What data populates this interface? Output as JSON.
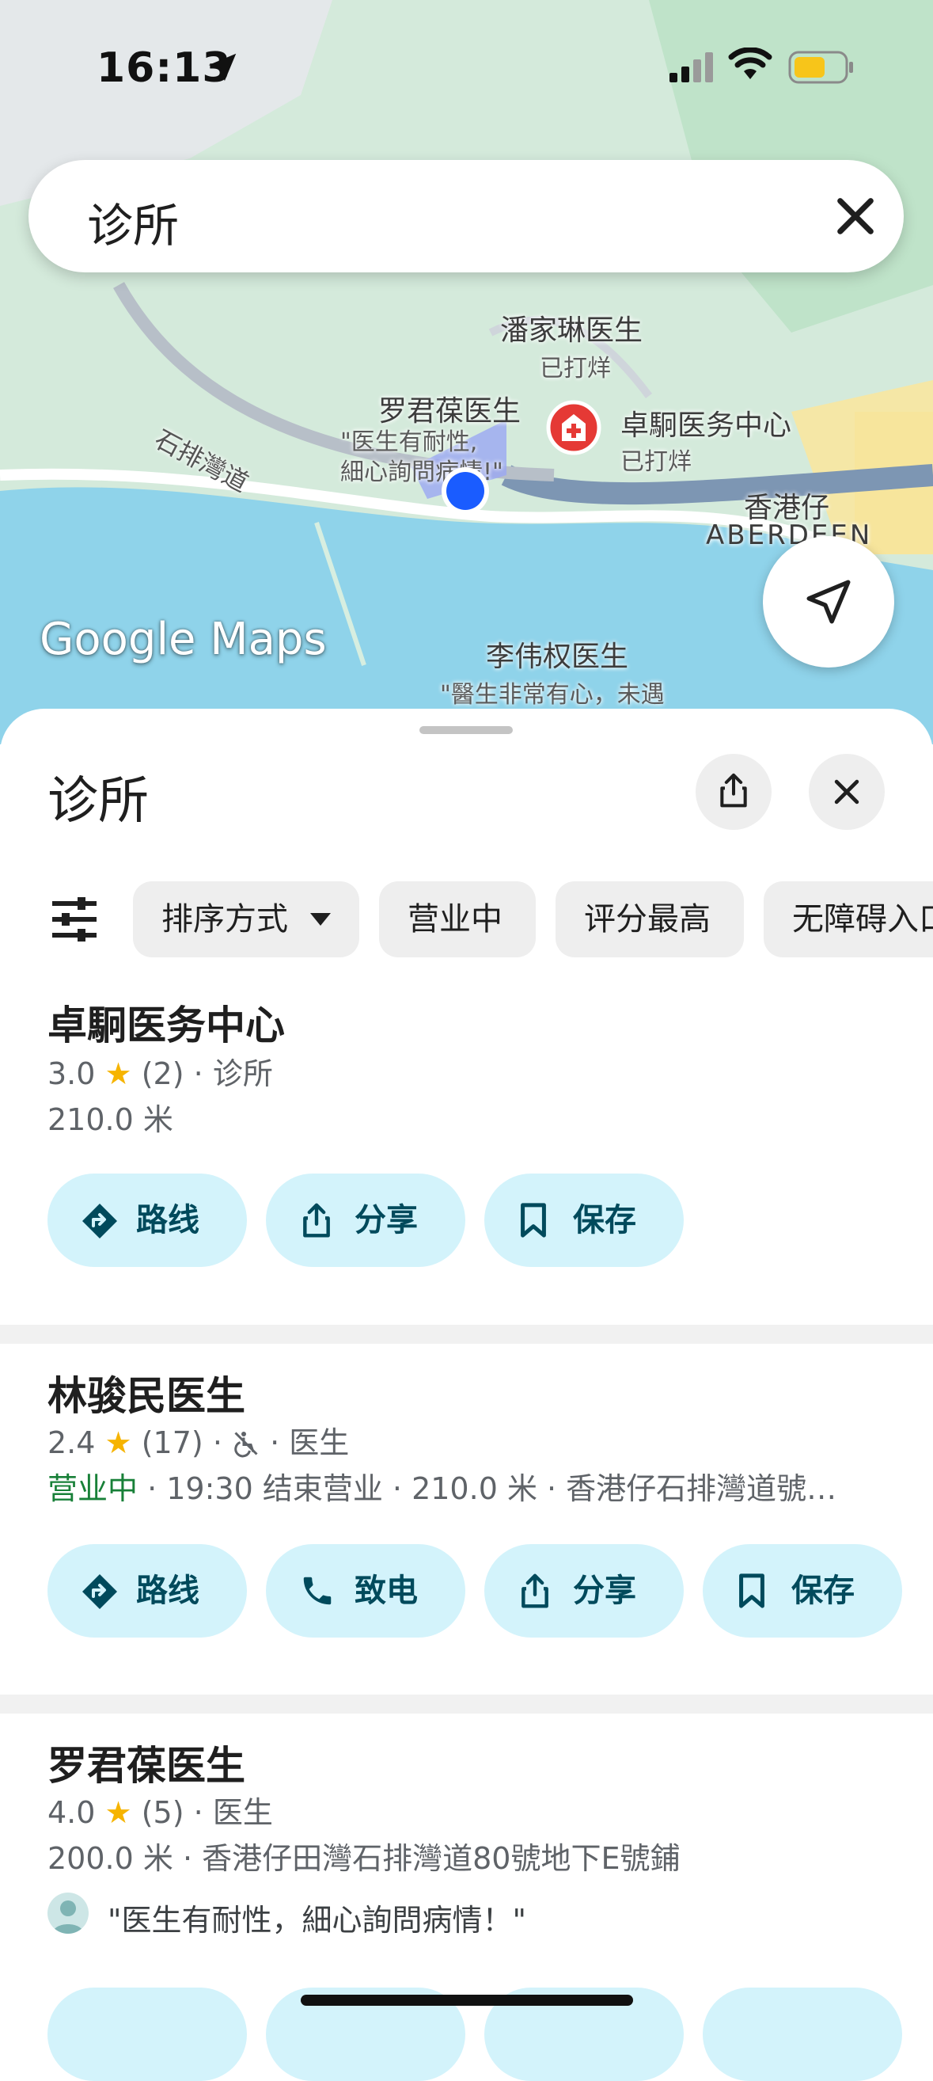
{
  "status_bar": {
    "time": "16:13"
  },
  "search": {
    "query": "诊所"
  },
  "map": {
    "place_labels": [
      {
        "name": "潘家琳医生",
        "sub": "已打烊"
      },
      {
        "name": "罗君葆医生",
        "sub": "\"医生有耐性,\n細心詢問病情!\""
      },
      {
        "name": "卓駉医务中心",
        "sub": "已打烊"
      },
      {
        "name": "香港仔",
        "sub": "ABERDEEN"
      },
      {
        "name": "李伟权医生",
        "sub": "\"醫生非常有心，未遇"
      }
    ],
    "road_label": "石排灣道",
    "logo": "Google Maps"
  },
  "sheet": {
    "title": "诊所",
    "filters": [
      "排序方式",
      "营业中",
      "评分最高",
      "无障碍入口"
    ]
  },
  "results": [
    {
      "name": "卓駉医务中心",
      "rating": "3.0",
      "reviews": "(2)",
      "category": "诊所",
      "distance": "210.0 米",
      "actions": [
        "路线",
        "分享",
        "保存"
      ]
    },
    {
      "name": "林骏民医生",
      "rating": "2.4",
      "reviews": "(17)",
      "category": "医生",
      "open_status": "营业中",
      "hours_detail": " · 19:30 结束营业 · 210.0 米 · 香港仔石排灣道號…",
      "actions": [
        "路线",
        "致电",
        "分享",
        "保存"
      ]
    },
    {
      "name": "罗君葆医生",
      "rating": "4.0",
      "reviews": "(5)",
      "category": "医生",
      "address_line": "200.0 米 · 香港仔田灣石排灣道80號地下E號鋪",
      "review_snippet": "\"医生有耐性，細心詢問病情！\""
    }
  ],
  "colors": {
    "accent_chip": "#d3f3fb",
    "accent_text": "#004a5c",
    "star": "#f6b400",
    "open": "#188038",
    "water": "#8fd3ea"
  }
}
